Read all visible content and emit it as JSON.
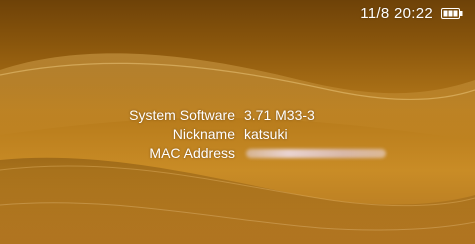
{
  "status": {
    "clock": "11/8 20:22",
    "battery_icon": "battery-full-icon"
  },
  "system_info": {
    "rows": [
      {
        "label": "System Software",
        "value": "3.71 M33-3"
      },
      {
        "label": "Nickname",
        "value": "katsuki"
      },
      {
        "label": "MAC Address",
        "value": ""
      }
    ]
  },
  "theme": {
    "background": "#b5791a",
    "text": "#ffffff"
  }
}
